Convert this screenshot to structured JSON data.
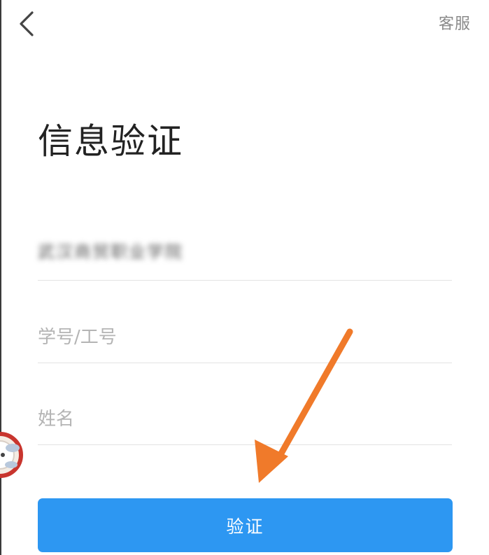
{
  "header": {
    "back_icon": "chevron-left-icon",
    "service_label": "客服"
  },
  "main": {
    "title": "信息验证",
    "fields": {
      "school": {
        "value": "武汉商贸职业学院",
        "blurred": true
      },
      "student_id": {
        "value": "",
        "placeholder": "学号/工号"
      },
      "name": {
        "value": "",
        "placeholder": "姓名"
      }
    },
    "verify_button_label": "验证"
  },
  "annotation": {
    "icon": "arrow-pointer-icon",
    "color": "#f07a2a"
  },
  "colors": {
    "accent": "#2d97f2",
    "title_text": "#222222",
    "placeholder": "#b4b4b4",
    "divider": "#e3e3e3",
    "service_text": "#8a8a8a"
  }
}
